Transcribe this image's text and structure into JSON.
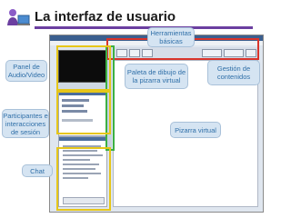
{
  "slide": {
    "title": "La interfaz de usuario",
    "accent_color": "#6b3fa0",
    "logo_icon": "user-at-computer-icon"
  },
  "callouts": {
    "herramientas": "Herramientas básicas",
    "paleta": "Paleta de dibujo de la pizarra virtual",
    "gestion": "Gestión de contenidos",
    "pizarra": "Pizarra virtual",
    "audio_video": "Panel de Audio/Video",
    "participantes": "Participantes e interacciones de sesión",
    "chat": "Chat"
  },
  "frame_colors": {
    "toolbar": "#d9342b",
    "palette": "#3cb043",
    "panels": "#e6c619"
  }
}
